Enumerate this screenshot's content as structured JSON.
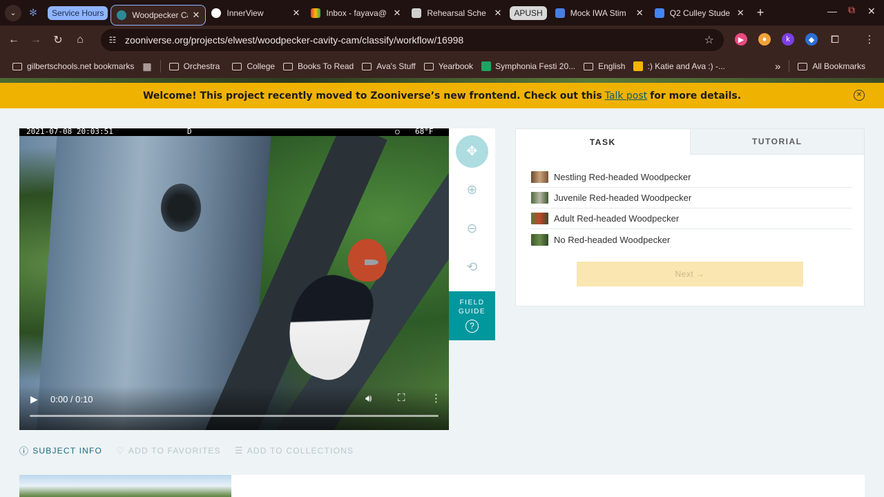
{
  "browser": {
    "tabs": [
      {
        "group": "Service Hours"
      },
      {
        "title": "Woodpecker Ca",
        "active": true
      },
      {
        "title": "InnerView"
      },
      {
        "title": "Inbox - fayava@"
      },
      {
        "title": "Rehearsal Sche"
      },
      {
        "group": "APUSH"
      },
      {
        "title": "Mock IWA Stim"
      },
      {
        "title": "Q2 Culley Stude"
      }
    ],
    "url": "zooniverse.org/projects/elwest/woodpecker-cavity-cam/classify/workflow/16998",
    "bookmarks": [
      "gilbertschools.net bookmarks",
      "Orchestra",
      "College",
      "Books To Read",
      "Ava's Stuff",
      "Yearbook",
      "Symphonia Festi 20...",
      "English",
      ":) Katie and Ava :) -...",
      "All Bookmarks"
    ]
  },
  "banner": {
    "text_before": "Welcome! This project recently moved to Zooniverse’s new frontend. Check out this",
    "link": "Talk post",
    "text_after": "for more details."
  },
  "video": {
    "timestamp": "2021-07-08 20:03:51",
    "camera_letter": "D",
    "temperature": "68°F",
    "time_display": "0:00 / 0:10",
    "progress": 0
  },
  "viewer_toolbar": {
    "field_guide_label": "FIELD GUIDE"
  },
  "meta_actions": {
    "subject_info": "SUBJECT INFO",
    "favorites": "ADD TO FAVORITES",
    "collections": "ADD TO COLLECTIONS"
  },
  "task_panel": {
    "tab_task": "TASK",
    "tab_tutorial": "TUTORIAL",
    "choices": [
      "Nestling Red-headed Woodpecker",
      "Juvenile Red-headed Woodpecker",
      "Adult Red-headed Woodpecker",
      "No Red-headed Woodpecker"
    ],
    "next_label": "Next →"
  },
  "colors": {
    "banner": "#f0b200",
    "teal": "#00979d",
    "link": "#0b5c74",
    "next_disabled": "#f9e6b0"
  }
}
